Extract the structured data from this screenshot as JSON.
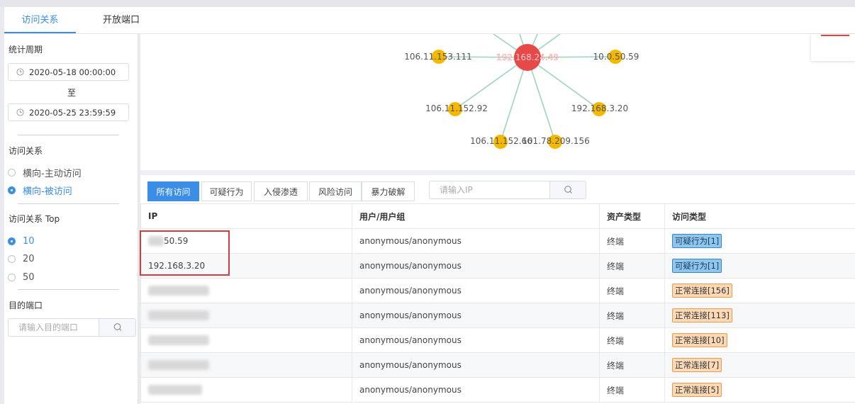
{
  "top_tabs": [
    "访问关系",
    "开放端口"
  ],
  "left": {
    "period_title": "统计周期",
    "start_date": "2020-05-18 00:00:00",
    "to_label": "至",
    "end_date": "2020-05-25 23:59:59",
    "relation_title": "访问关系",
    "relation_options": [
      "横向-主动访问",
      "横向-被访问"
    ],
    "relation_selected": "横向-被访问",
    "top_title": "访问关系 Top",
    "top_options": [
      "10",
      "20",
      "50"
    ],
    "top_selected": "10",
    "port_title": "目的端口",
    "port_placeholder": "请输入目的端口"
  },
  "graph": {
    "center": "192.168.24.49",
    "nodes": [
      "106.11.153.111",
      "10.0.50.59",
      "106.11.152.92",
      "192.168.3.20",
      "106.11.152.66",
      "101.78.209.156"
    ],
    "colors": {
      "center": "#e74848",
      "node": "#f5b800",
      "edge": "#9ed4b8"
    }
  },
  "filter_tabs": [
    "所有访问",
    "可疑行为",
    "入侵渗透",
    "风险访问",
    "暴力破解"
  ],
  "active_filter": "所有访问",
  "ip_search_placeholder": "请输入IP",
  "table": {
    "headers": [
      "IP",
      "用户/用户组",
      "资产类型",
      "访问类型"
    ],
    "rows": [
      {
        "ip": "50.59",
        "user": "anonymous/anonymous",
        "asset": "终端",
        "type": "可疑行为[1]",
        "kind": "suspicious"
      },
      {
        "ip": "192.168.3.20",
        "user": "anonymous/anonymous",
        "asset": "终端",
        "type": "可疑行为[1]",
        "kind": "suspicious"
      },
      {
        "ip": "",
        "user": "anonymous/anonymous",
        "asset": "终端",
        "type": "正常连接[156]",
        "kind": "normal"
      },
      {
        "ip": "",
        "user": "anonymous/anonymous",
        "asset": "终端",
        "type": "正常连接[113]",
        "kind": "normal"
      },
      {
        "ip": "",
        "user": "anonymous/anonymous",
        "asset": "终端",
        "type": "正常连接[10]",
        "kind": "normal"
      },
      {
        "ip": "",
        "user": "anonymous/anonymous",
        "asset": "终端",
        "type": "正常连接[7]",
        "kind": "normal"
      },
      {
        "ip": "",
        "user": "anonymous/anonymous",
        "asset": "终端",
        "type": "正常连接[5]",
        "kind": "normal"
      }
    ]
  }
}
